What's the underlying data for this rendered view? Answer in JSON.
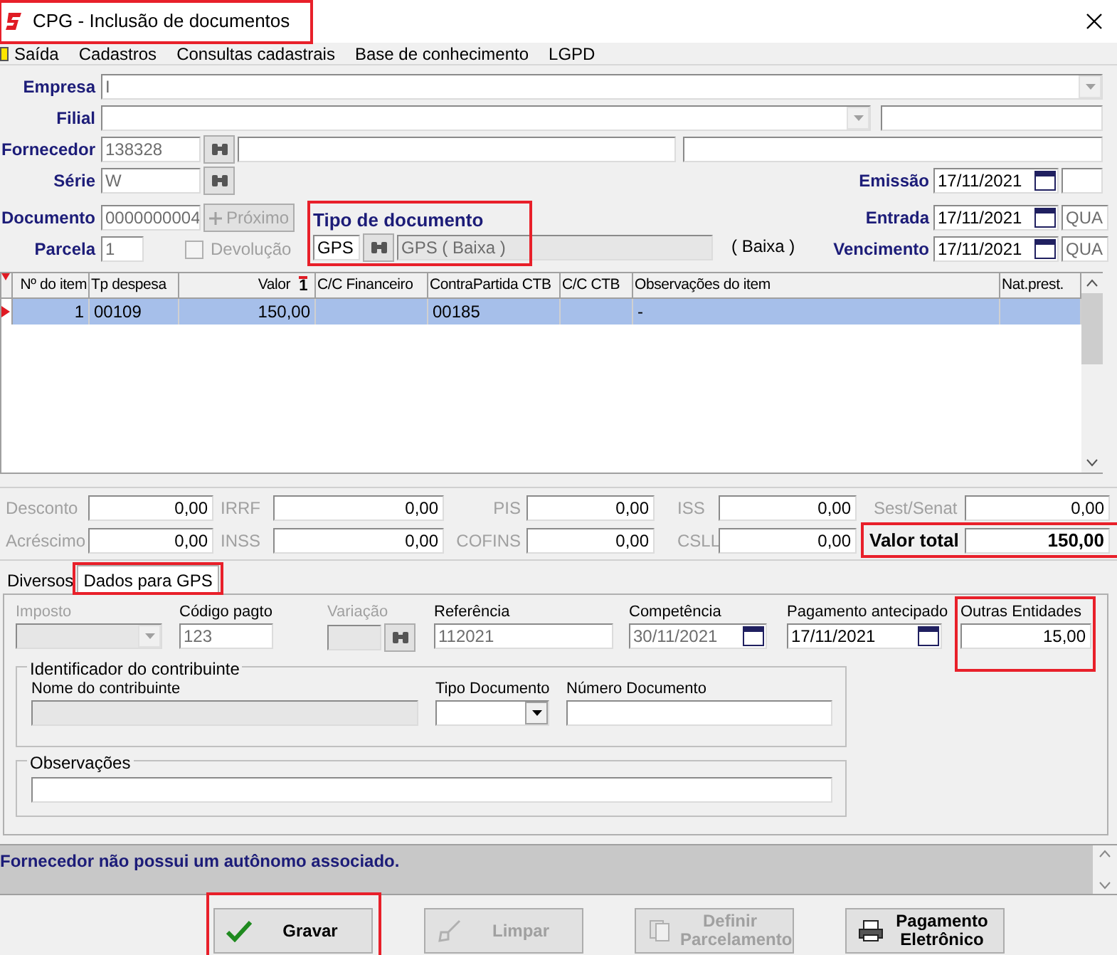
{
  "window": {
    "title": "CPG - Inclusão de documentos",
    "highlighted": true
  },
  "menu": [
    {
      "label": "Saída"
    },
    {
      "label": "Cadastros"
    },
    {
      "label": "Consultas cadastrais"
    },
    {
      "label": "Base de conhecimento"
    },
    {
      "label": "LGPD"
    }
  ],
  "header": {
    "empresa": {
      "label": "Empresa",
      "value": "I"
    },
    "filial": {
      "label": "Filial"
    },
    "fornecedor": {
      "label": "Fornecedor",
      "value": "138328"
    },
    "serie": {
      "label": "Série",
      "value": "W"
    },
    "documento": {
      "label": "Documento",
      "value": "0000000004"
    },
    "proximo": {
      "label": "Próximo",
      "disabled": true
    },
    "parcela": {
      "label": "Parcela",
      "value": "1"
    },
    "devolucao": {
      "label": "Devolução",
      "checked": false,
      "disabled": true
    },
    "tipo_documento": {
      "label": "Tipo de documento",
      "code": "GPS",
      "description": "GPS ( Baixa )",
      "note": "( Baixa )",
      "highlighted": true
    },
    "emissao": {
      "label": "Emissão",
      "value": "17/11/2021"
    },
    "entrada": {
      "label": "Entrada",
      "value": "17/11/2021",
      "weekday": "QUA"
    },
    "vencimento": {
      "label": "Vencimento",
      "value": "17/11/2021",
      "weekday": "QUA"
    }
  },
  "items_table": {
    "columns": [
      {
        "label": "Nº do item"
      },
      {
        "label": "Tp despesa"
      },
      {
        "label": "Valor",
        "sort": "1"
      },
      {
        "label": "C/C Financeiro"
      },
      {
        "label": "ContraPartida CTB"
      },
      {
        "label": "C/C CTB"
      },
      {
        "label": "Observações do item"
      },
      {
        "label": "Nat.prest."
      }
    ],
    "rows": [
      {
        "selected": true,
        "cells": [
          "1",
          "00109",
          "150,00",
          null,
          "00185",
          null,
          "-",
          null
        ]
      }
    ]
  },
  "totals": [
    [
      {
        "kind": "tax",
        "label": "Desconto",
        "value": "0,00"
      },
      {
        "kind": "tax",
        "label": "IRRF",
        "value": "0,00"
      },
      {
        "kind": "tax",
        "label": "PIS",
        "value": "0,00"
      },
      {
        "kind": "tax",
        "label": "ISS",
        "value": "0,00"
      },
      {
        "kind": "tax",
        "label": "Sest/Senat",
        "value": "0,00"
      }
    ],
    [
      {
        "kind": "tax",
        "label": "Acréscimo",
        "value": "0,00"
      },
      {
        "kind": "tax",
        "label": "INSS",
        "value": "0,00"
      },
      {
        "kind": "tax",
        "label": "COFINS",
        "value": "0,00"
      },
      {
        "kind": "tax",
        "label": "CSLL",
        "value": "0,00"
      },
      {
        "kind": "total",
        "label": "Valor total",
        "value": "150,00",
        "highlighted": true
      }
    ]
  ],
  "tabs": [
    {
      "label": "Diversos",
      "selected": false
    },
    {
      "label": "Dados para GPS",
      "selected": true,
      "highlighted": true
    }
  ],
  "gps": {
    "imposto": {
      "label": "Imposto",
      "disabled": true
    },
    "codigo_pagto": {
      "label": "Código pagto",
      "value": "123"
    },
    "variacao": {
      "label": "Variação",
      "disabled": true
    },
    "referencia": {
      "label": "Referência",
      "value": "112021"
    },
    "competencia": {
      "label": "Competência",
      "value": "30/11/2021"
    },
    "pagamento_antecipado": {
      "label": "Pagamento antecipado",
      "value": "17/11/2021"
    },
    "outras_entidades": {
      "label": "Outras Entidades",
      "value": "15,00",
      "highlighted": true
    },
    "contribuinte": {
      "title": "Identificador do contribuinte",
      "nome_label": "Nome do contribuinte",
      "tipo_label": "Tipo Documento",
      "numero_label": "Número Documento"
    },
    "observacoes": {
      "title": "Observações"
    }
  },
  "status_message": "Fornecedor não possui um autônomo associado.",
  "buttons": [
    {
      "kind": "save",
      "label": "Gravar",
      "disabled": false,
      "highlighted": true
    },
    {
      "kind": "clear",
      "label": "Limpar",
      "disabled": true
    },
    {
      "kind": "installments",
      "label": "Definir Parcelamento",
      "disabled": true
    },
    {
      "kind": "payment",
      "label": "Pagamento Eletrônico",
      "disabled": false
    }
  ]
}
